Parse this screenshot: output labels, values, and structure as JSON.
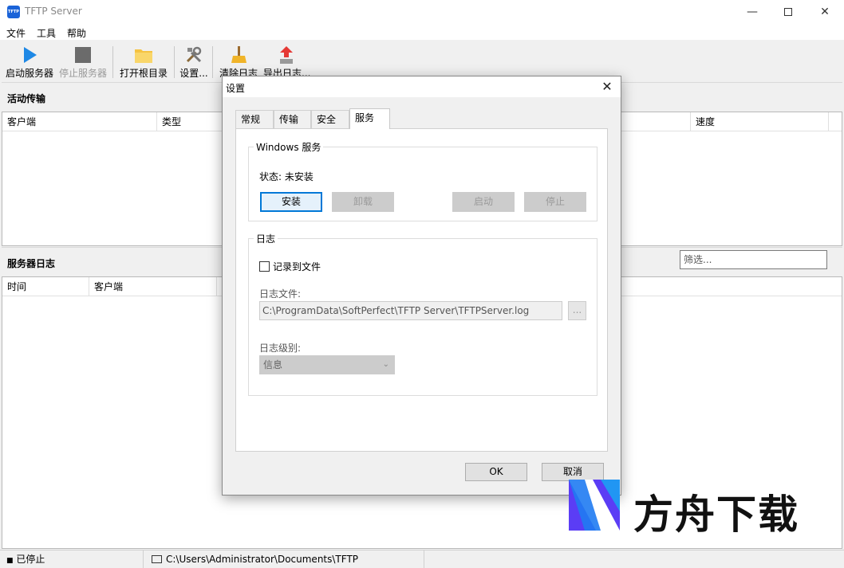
{
  "window": {
    "title": "TFTP Server",
    "app_icon_text": "TFTP"
  },
  "menu": [
    "文件",
    "工具",
    "帮助"
  ],
  "toolbar": {
    "start": "启动服务器",
    "stop": "停止服务器",
    "open_root": "打开根目录",
    "settings": "设置...",
    "clear_log": "清除日志",
    "export_log": "导出日志..."
  },
  "active_transfers": {
    "title": "活动传输",
    "columns": [
      "客户端",
      "类型",
      "速度"
    ]
  },
  "server_log": {
    "title": "服务器日志",
    "filter_placeholder": "筛选...",
    "columns": [
      "时间",
      "客户端"
    ]
  },
  "statusbar": {
    "status": "已停止",
    "path": "C:\\Users\\Administrator\\Documents\\TFTP"
  },
  "dialog": {
    "title": "设置",
    "close_glyph": "✕",
    "tabs": [
      "常规",
      "传输",
      "安全",
      "服务"
    ],
    "active_tab": "服务",
    "service_group": {
      "title": "Windows 服务",
      "status": "状态: 未安装",
      "install": "安装",
      "uninstall": "卸载",
      "start": "启动",
      "stop": "停止"
    },
    "log_group": {
      "title": "日志",
      "log_to_file": "记录到文件",
      "log_file_label": "日志文件:",
      "log_file_path": "C:\\ProgramData\\SoftPerfect\\TFTP Server\\TFTPServer.log",
      "browse": "...",
      "log_level_label": "日志级别:",
      "log_level_value": "信息"
    },
    "ok": "OK",
    "cancel": "取消"
  },
  "watermark": {
    "text": "方舟下载"
  }
}
